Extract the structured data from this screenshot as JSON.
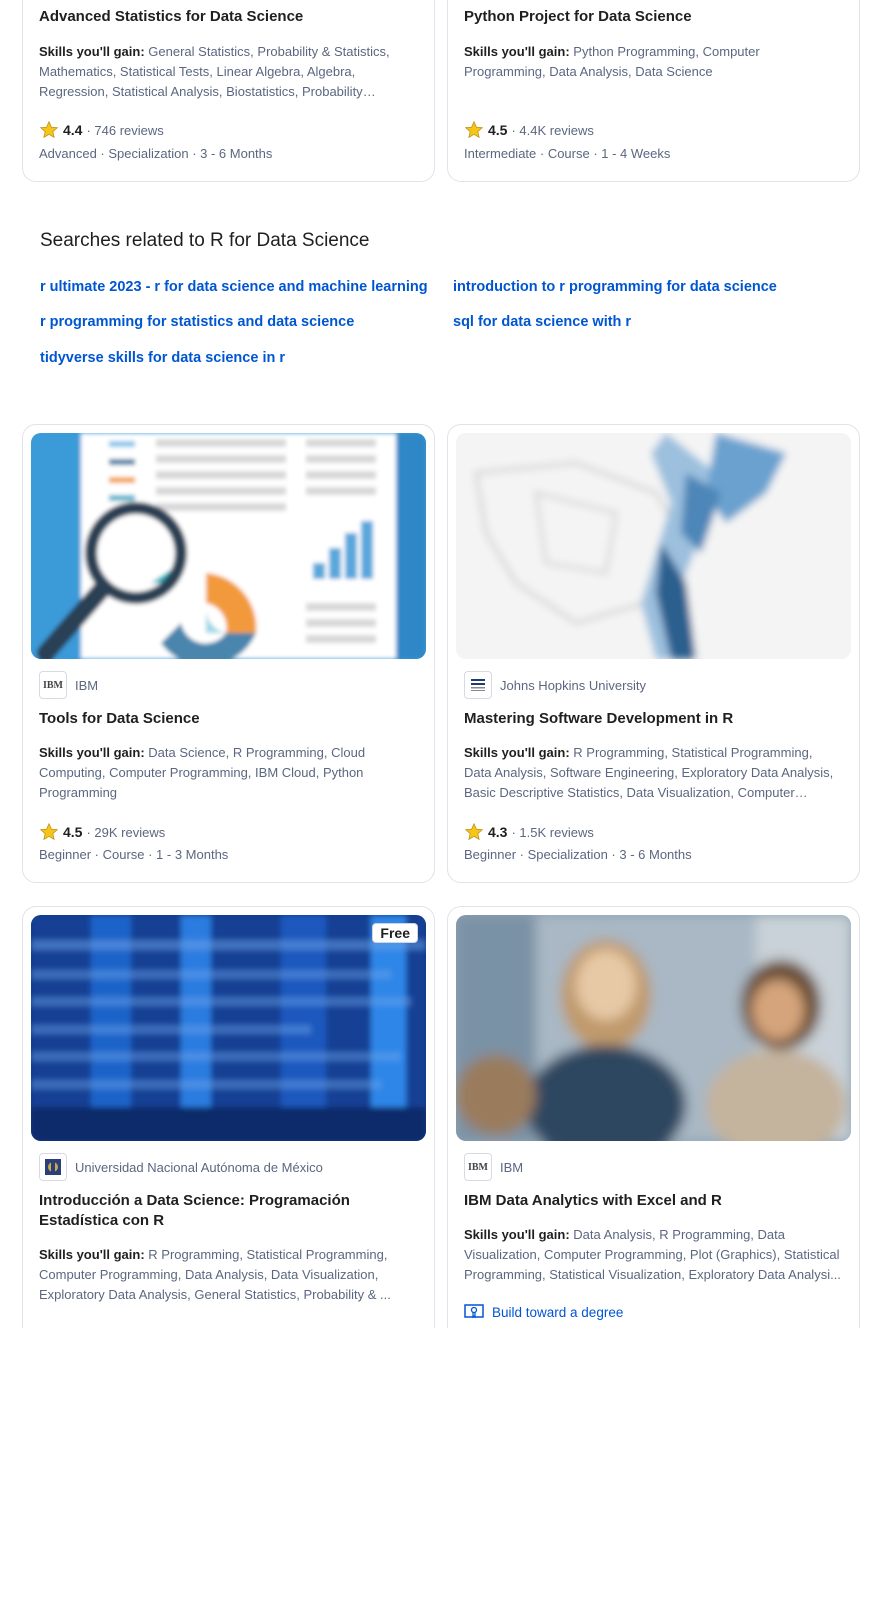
{
  "skills_label": "Skills you'll gain:",
  "cards": [
    {
      "title": "Advanced Statistics for Data Science",
      "skills": "General Statistics, Probability & Statistics, Mathematics, Statistical Tests, Linear Algebra, Algebra, Regression, Statistical Analysis, Biostatistics, Probability Distribution, ...",
      "rating": "4.4",
      "reviews": "746 reviews",
      "meta": "Advanced · Specialization · 3 - 6 Months"
    },
    {
      "title": "Python Project for Data Science",
      "skills": "Python Programming, Computer Programming, Data Analysis, Data Science",
      "rating": "4.5",
      "reviews": "4.4K reviews",
      "meta": "Intermediate · Course · 1 - 4 Weeks"
    },
    {
      "partner": "IBM",
      "partner_logo_text": "IBM",
      "title": "Tools for Data Science",
      "skills": "Data Science, R Programming, Cloud Computing, Computer Programming, IBM Cloud, Python Programming",
      "rating": "4.5",
      "reviews": "29K reviews",
      "meta": "Beginner · Course · 1 - 3 Months"
    },
    {
      "partner": "Johns Hopkins University",
      "title": "Mastering Software Development in R",
      "skills": "R Programming, Statistical Programming, Data Analysis, Software Engineering, Exploratory Data Analysis, Basic Descriptive Statistics, Data Visualization, Computer Programming",
      "rating": "4.3",
      "reviews": "1.5K reviews",
      "meta": "Beginner · Specialization · 3 - 6 Months"
    },
    {
      "badge": "Free",
      "partner": "Universidad Nacional Autónoma de México",
      "title": "Introducción a Data Science: Programación Estadística con R",
      "skills": "R Programming, Statistical Programming, Computer Programming, Data Analysis, Data Visualization, Exploratory Data Analysis, General Statistics, Probability & ..."
    },
    {
      "partner": "IBM",
      "partner_logo_text": "IBM",
      "title": "IBM Data Analytics with Excel and R",
      "skills": "Data Analysis, R Programming, Data Visualization, Computer Programming, Plot (Graphics), Statistical Programming, Statistical Visualization, Exploratory Data Analysi...",
      "degree_link": "Build toward a degree"
    }
  ],
  "related": {
    "title": "Searches related to R for Data Science",
    "links": [
      "r ultimate 2023 - r for data science and machine learning",
      "introduction to r programming for data science",
      "r programming for statistics and data science",
      "sql for data science with r",
      "tidyverse skills for data science in r"
    ]
  },
  "colors": {
    "link": "#0056d2",
    "star": "#f5c518",
    "muted": "#5b6780",
    "border": "#dfe3ea"
  }
}
